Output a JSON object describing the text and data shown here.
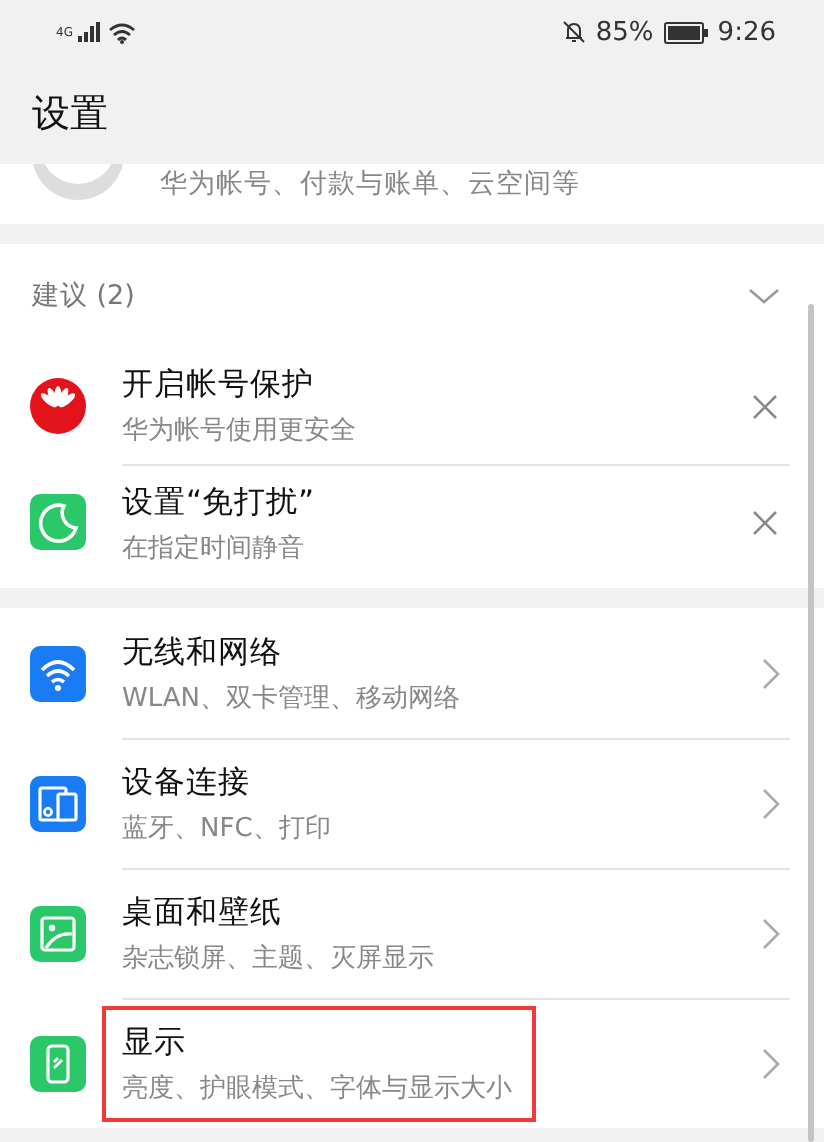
{
  "status_bar": {
    "network": "4G",
    "battery_percent": "85%",
    "time": "9:26"
  },
  "title": "设置",
  "account": {
    "subtitle": "华为帐号、付款与账单、云空间等"
  },
  "suggestions": {
    "header": "建议 (2)",
    "expanded": true,
    "items": [
      {
        "title": "开启帐号保护",
        "subtitle": "华为帐号使用更安全"
      },
      {
        "title": "设置“免打扰”",
        "subtitle": "在指定时间静音"
      }
    ]
  },
  "settings": [
    {
      "title": "无线和网络",
      "subtitle": "WLAN、双卡管理、移动网络",
      "highlighted": false
    },
    {
      "title": "设备连接",
      "subtitle": "蓝牙、NFC、打印",
      "highlighted": false
    },
    {
      "title": "桌面和壁纸",
      "subtitle": "杂志锁屏、主题、灭屏显示",
      "highlighted": false
    },
    {
      "title": "显示",
      "subtitle": "亮度、护眼模式、字体与显示大小",
      "highlighted": true
    }
  ]
}
